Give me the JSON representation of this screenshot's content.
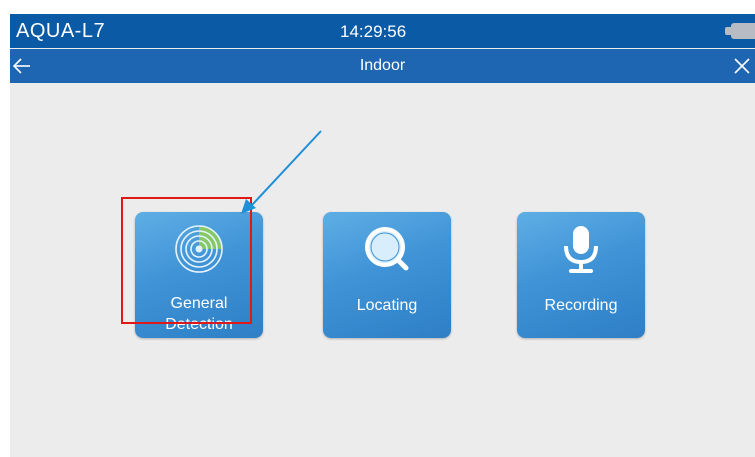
{
  "status_bar": {
    "device_name": "AQUA-L7",
    "time": "14:29:56"
  },
  "title_bar": {
    "title": "Indoor"
  },
  "tiles": [
    {
      "label_line1": "General",
      "label_line2": "Detection",
      "icon": "radar-icon"
    },
    {
      "label": "Locating",
      "icon": "magnifier-icon"
    },
    {
      "label": "Recording",
      "icon": "microphone-icon"
    }
  ],
  "colors": {
    "status_bar_bg": "#0a5aa6",
    "title_bar_bg": "#1f66b2",
    "tile_bg": "#3f93d6",
    "screen_bg": "#ececec",
    "highlight_border": "#e01818",
    "annotation_arrow": "#1e8fd9"
  }
}
